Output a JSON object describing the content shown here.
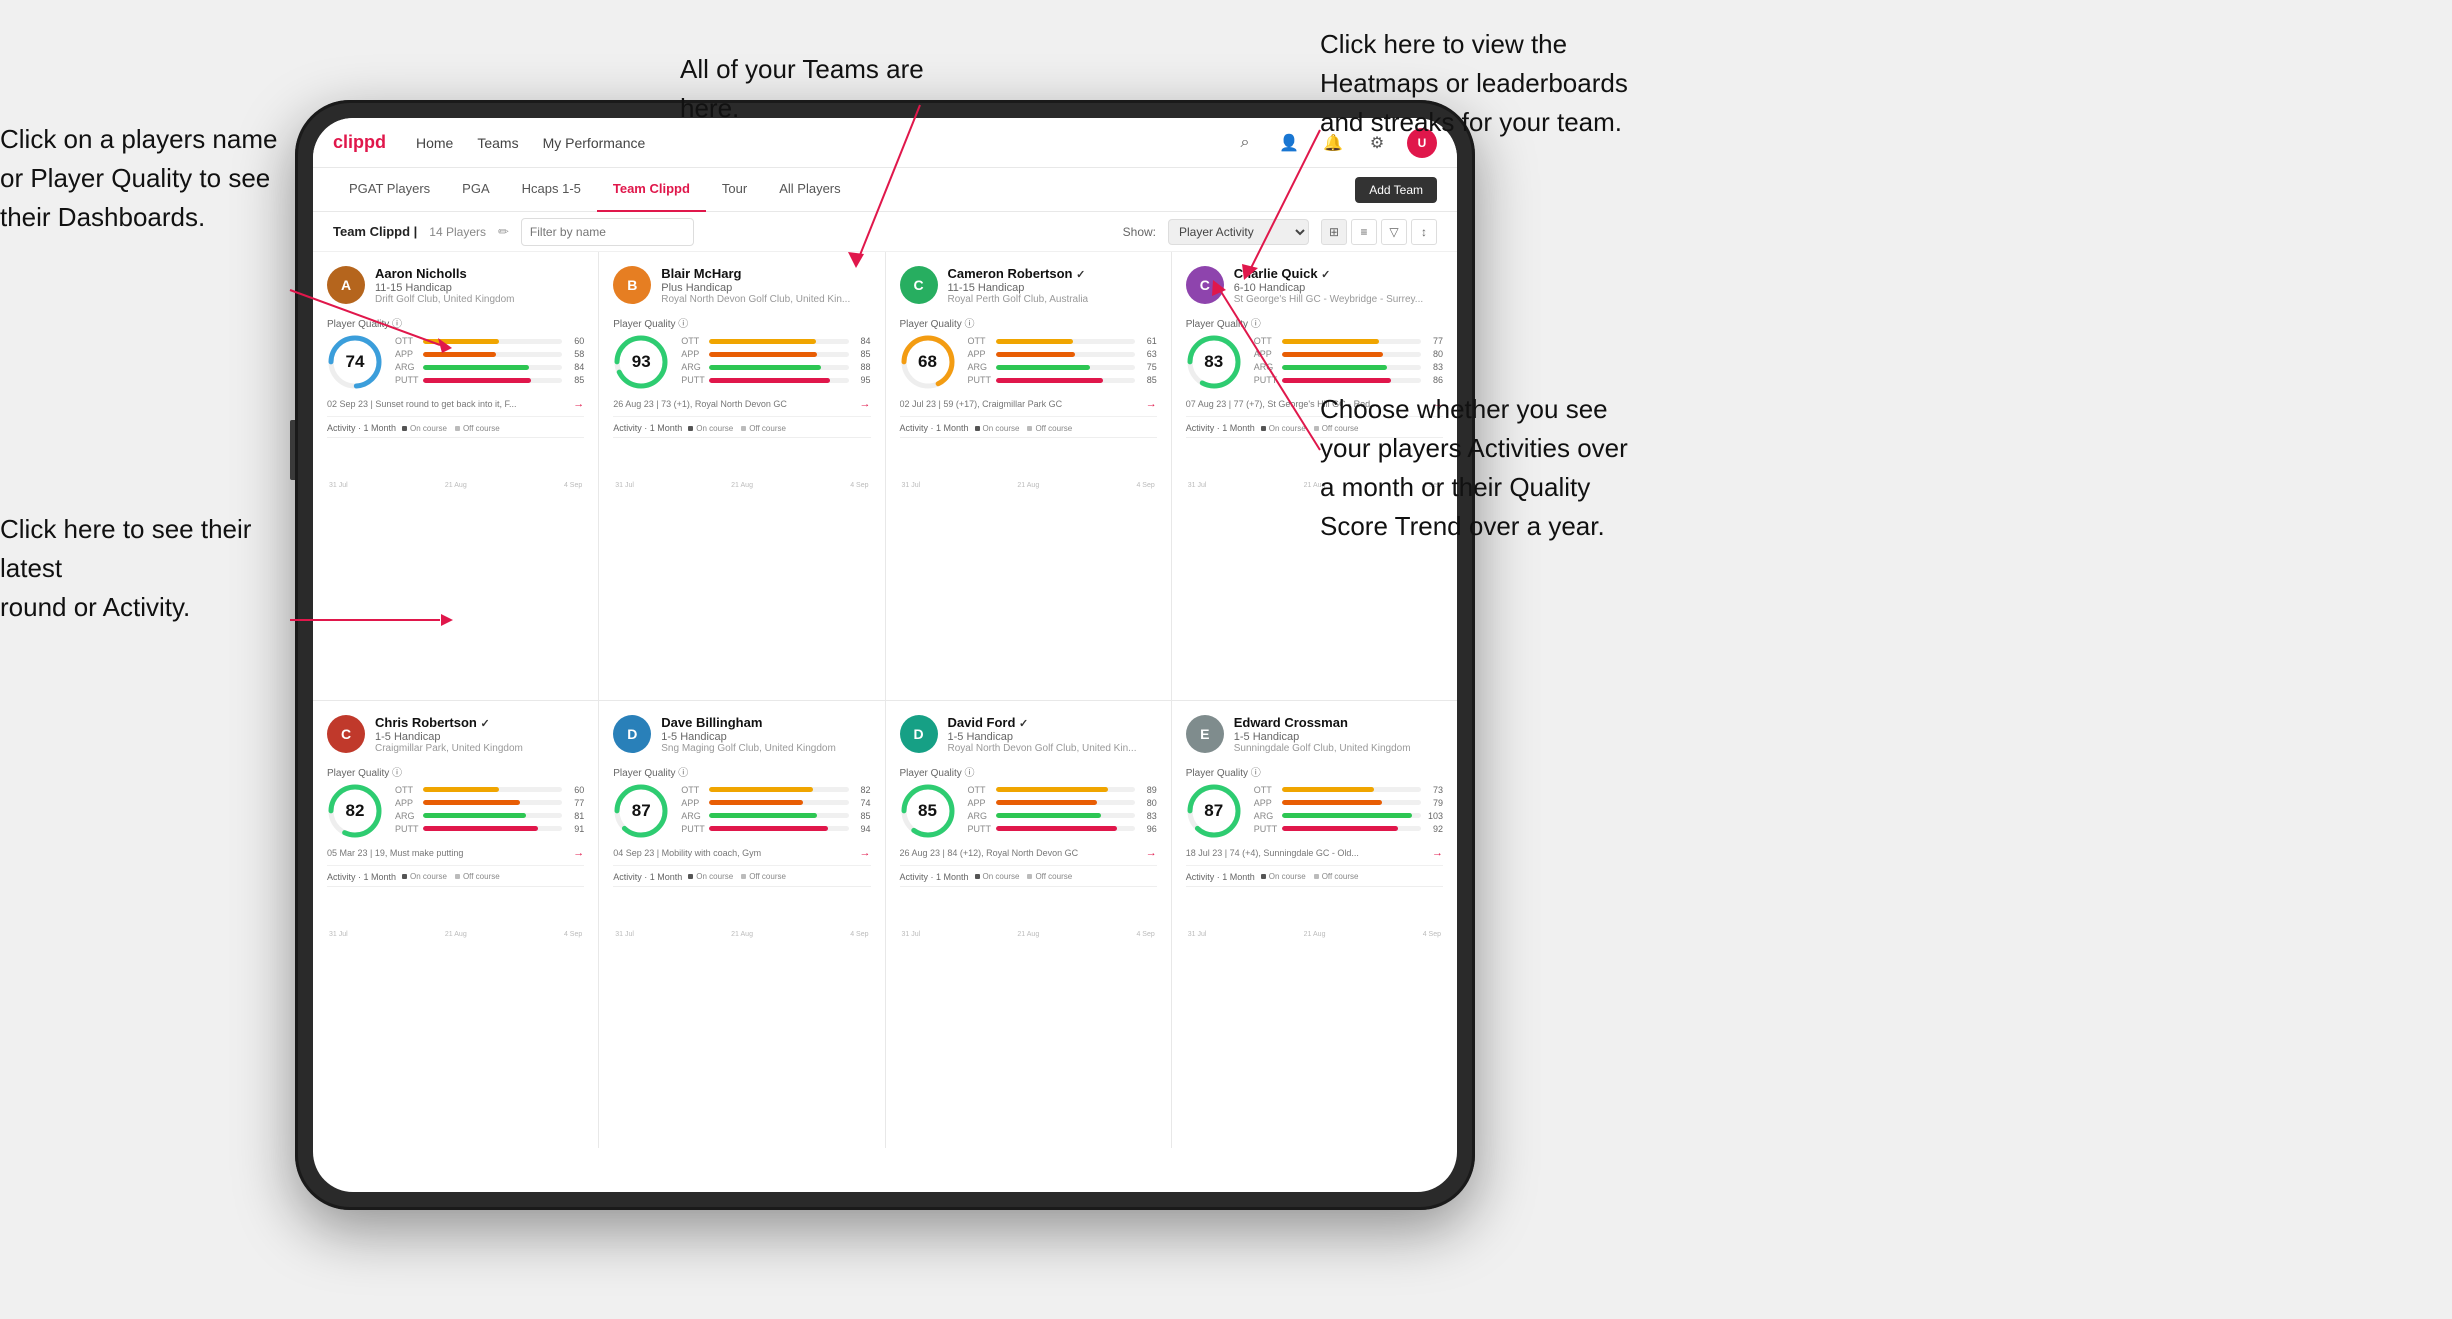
{
  "annotations": {
    "top_center": "All of your Teams are here.",
    "top_right": "Click here to view the\nHeatmaps or leaderboards\nand streaks for your team.",
    "left_top": "Click on a players name\nor Player Quality to see\ntheir Dashboards.",
    "left_bottom": "Click here to see their latest\nround or Activity.",
    "right_bottom": "Choose whether you see\nyour players Activities over\na month or their Quality\nScore Trend over a year."
  },
  "app": {
    "brand": "clippd",
    "nav_links": [
      "Home",
      "Teams",
      "My Performance"
    ],
    "sub_tabs": [
      "PGAT Players",
      "PGA",
      "Hcaps 1-5",
      "Team Clippd",
      "Tour",
      "All Players"
    ],
    "active_tab": "Team Clippd",
    "add_team": "Add Team",
    "team_name": "Team Clippd",
    "team_count": "14 Players",
    "filter_placeholder": "Filter by name",
    "show_label": "Show:",
    "show_option": "Player Activity"
  },
  "players": [
    {
      "name": "Aaron Nicholls",
      "handicap": "11-15 Handicap",
      "club": "Drift Golf Club, United Kingdom",
      "score": 74,
      "score_color": "#3b9edb",
      "stats": {
        "OTT": 60,
        "APP": 58,
        "ARG": 84,
        "PUTT": 85
      },
      "latest_round": "02 Sep 23 | Sunset round to get back into it, F...",
      "avatar_bg": "#b5651d",
      "avatar_letter": "A"
    },
    {
      "name": "Blair McHarg",
      "handicap": "Plus Handicap",
      "club": "Royal North Devon Golf Club, United Kin...",
      "score": 93,
      "score_color": "#2ecc71",
      "stats": {
        "OTT": 84,
        "APP": 85,
        "ARG": 88,
        "PUTT": 95
      },
      "latest_round": "26 Aug 23 | 73 (+1), Royal North Devon GC",
      "avatar_bg": "#e67e22",
      "avatar_letter": "B"
    },
    {
      "name": "Cameron Robertson",
      "handicap": "11-15 Handicap",
      "club": "Royal Perth Golf Club, Australia",
      "score": 68,
      "score_color": "#f39c12",
      "stats": {
        "OTT": 61,
        "APP": 63,
        "ARG": 75,
        "PUTT": 85
      },
      "latest_round": "02 Jul 23 | 59 (+17), Craigmillar Park GC",
      "avatar_bg": "#27ae60",
      "avatar_letter": "C",
      "verified": true
    },
    {
      "name": "Charlie Quick",
      "handicap": "6-10 Handicap",
      "club": "St George's Hill GC - Weybridge - Surrey...",
      "score": 83,
      "score_color": "#2ecc71",
      "stats": {
        "OTT": 77,
        "APP": 80,
        "ARG": 83,
        "PUTT": 86
      },
      "latest_round": "07 Aug 23 | 77 (+7), St George's Hill GC - Red...",
      "avatar_bg": "#8e44ad",
      "avatar_letter": "C",
      "verified": true
    },
    {
      "name": "Chris Robertson",
      "handicap": "1-5 Handicap",
      "club": "Craigmillar Park, United Kingdom",
      "score": 82,
      "score_color": "#2ecc71",
      "stats": {
        "OTT": 60,
        "APP": 77,
        "ARG": 81,
        "PUTT": 91
      },
      "latest_round": "05 Mar 23 | 19, Must make putting",
      "avatar_bg": "#c0392b",
      "avatar_letter": "C",
      "verified": true
    },
    {
      "name": "Dave Billingham",
      "handicap": "1-5 Handicap",
      "club": "Sng Maging Golf Club, United Kingdom",
      "score": 87,
      "score_color": "#2ecc71",
      "stats": {
        "OTT": 82,
        "APP": 74,
        "ARG": 85,
        "PUTT": 94
      },
      "latest_round": "04 Sep 23 | Mobility with coach, Gym",
      "avatar_bg": "#2980b9",
      "avatar_letter": "D"
    },
    {
      "name": "David Ford",
      "handicap": "1-5 Handicap",
      "club": "Royal North Devon Golf Club, United Kin...",
      "score": 85,
      "score_color": "#2ecc71",
      "stats": {
        "OTT": 89,
        "APP": 80,
        "ARG": 83,
        "PUTT": 96
      },
      "latest_round": "26 Aug 23 | 84 (+12), Royal North Devon GC",
      "avatar_bg": "#16a085",
      "avatar_letter": "D",
      "verified": true
    },
    {
      "name": "Edward Crossman",
      "handicap": "1-5 Handicap",
      "club": "Sunningdale Golf Club, United Kingdom",
      "score": 87,
      "score_color": "#2ecc71",
      "stats": {
        "OTT": 73,
        "APP": 79,
        "ARG": 103,
        "PUTT": 92
      },
      "latest_round": "18 Jul 23 | 74 (+4), Sunningdale GC - Old...",
      "avatar_bg": "#7f8c8d",
      "avatar_letter": "E"
    }
  ],
  "chart_labels": [
    "31 Jul",
    "21 Aug",
    "4 Sep"
  ],
  "stat_colors": {
    "OTT": "#f0a500",
    "APP": "#e85d04",
    "ARG": "#2dc653",
    "PUTT": "#e0174b"
  },
  "activity_header": "Activity",
  "activity_period": "1 Month",
  "legend_oncourse": "On course",
  "legend_offcourse": "Off course",
  "oncourse_color": "#555",
  "offcourse_color": "#aaa"
}
